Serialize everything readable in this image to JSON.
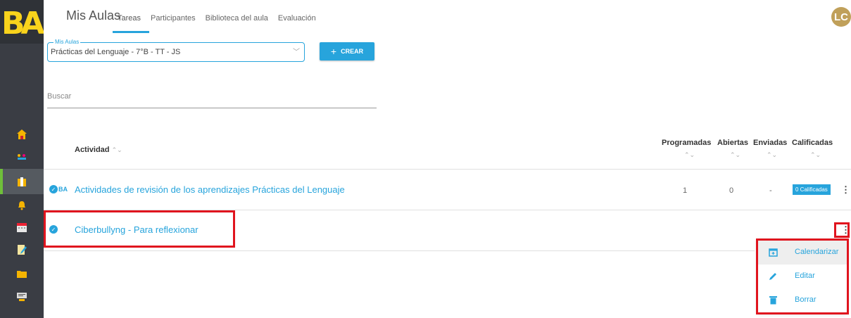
{
  "logo": {
    "text": "BA"
  },
  "header": {
    "title": "Mis Aulas",
    "tabs": [
      {
        "label": "Tareas"
      },
      {
        "label": "Participantes"
      },
      {
        "label": "Biblioteca del aula"
      },
      {
        "label": "Evaluación"
      }
    ],
    "avatar_initials": "LC"
  },
  "classroom_select": {
    "legend": "Mis Aulas",
    "value": "Prácticas del Lenguaje - 7°B - TT - JS"
  },
  "create_button": {
    "icon": "+",
    "label": "CREAR"
  },
  "search": {
    "placeholder": "Buscar"
  },
  "table": {
    "columns": {
      "activity": "Actividad",
      "scheduled": "Programadas",
      "open": "Abiertas",
      "sent": "Enviadas",
      "graded": "Calificadas"
    },
    "sort_glyph": "⌃⌄",
    "rows": [
      {
        "title": "Actividades de revisión de los aprendizajes Prácticas del Lenguaje",
        "tag": "BA",
        "scheduled": "1",
        "open": "0",
        "sent": "-",
        "graded_badge": "0 Calificadas"
      },
      {
        "title": "Ciberbullyng - Para reflexionar"
      }
    ]
  },
  "context_menu": {
    "items": [
      {
        "label": "Calendarizar",
        "icon": "calendar-add-icon"
      },
      {
        "label": "Editar",
        "icon": "pencil-icon"
      },
      {
        "label": "Borrar",
        "icon": "trash-icon"
      }
    ]
  },
  "colors": {
    "accent": "#27a4dc",
    "sidebar": "#3a3d44",
    "highlight": "#e0141e",
    "logo": "#f9d31c"
  }
}
